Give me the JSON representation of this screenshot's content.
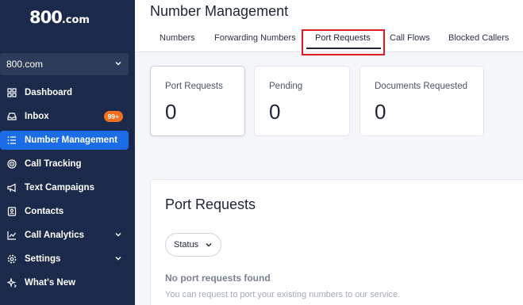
{
  "brand": {
    "logo_main": "800",
    "logo_suffix": ".com"
  },
  "account": {
    "selected": "800.com"
  },
  "sidebar": {
    "items": [
      {
        "label": "Dashboard",
        "icon": "grid-icon"
      },
      {
        "label": "Inbox",
        "icon": "inbox-icon",
        "badge": "99+"
      },
      {
        "label": "Number Management",
        "icon": "list-icon",
        "active": true
      },
      {
        "label": "Call Tracking",
        "icon": "target-icon"
      },
      {
        "label": "Text Campaigns",
        "icon": "megaphone-icon"
      },
      {
        "label": "Contacts",
        "icon": "contact-card-icon"
      },
      {
        "label": "Call Analytics",
        "icon": "chart-line-icon",
        "expandable": true
      },
      {
        "label": "Settings",
        "icon": "gear-icon",
        "expandable": true
      },
      {
        "label": "What's New",
        "icon": "sparkle-icon"
      }
    ]
  },
  "header": {
    "title": "Number Management",
    "tabs": [
      {
        "label": "Numbers"
      },
      {
        "label": "Forwarding Numbers"
      },
      {
        "label": "Port Requests",
        "active": true
      },
      {
        "label": "Call Flows"
      },
      {
        "label": "Blocked Callers"
      }
    ]
  },
  "stats": [
    {
      "label": "Port Requests",
      "value": "0"
    },
    {
      "label": "Pending",
      "value": "0"
    },
    {
      "label": "Documents Requested",
      "value": "0"
    }
  ],
  "panel": {
    "title": "Port Requests",
    "filter_label": "Status",
    "empty_title": "No port requests found",
    "empty_subtitle": "You can request to port your existing numbers to our service."
  },
  "colors": {
    "sidebar_bg": "#1b2a4a",
    "accent": "#1c6ce5",
    "badge": "#f26f1f",
    "highlight": "#e01b24"
  }
}
